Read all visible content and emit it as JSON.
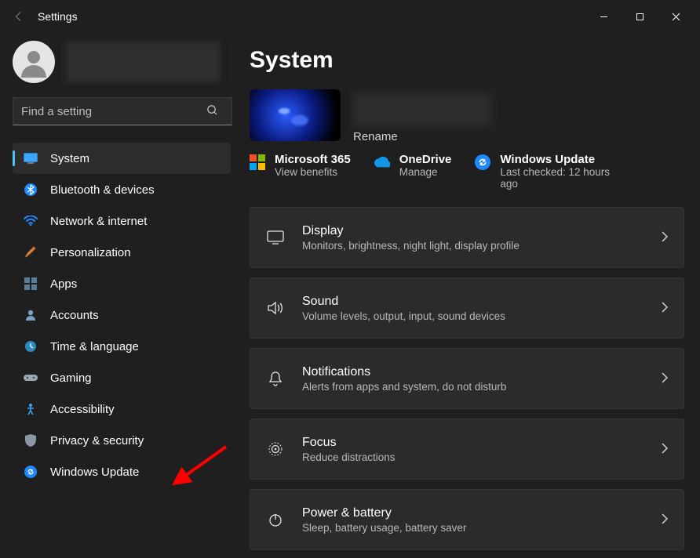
{
  "window": {
    "title": "Settings"
  },
  "search": {
    "placeholder": "Find a setting"
  },
  "nav": {
    "items": [
      {
        "label": "System"
      },
      {
        "label": "Bluetooth & devices"
      },
      {
        "label": "Network & internet"
      },
      {
        "label": "Personalization"
      },
      {
        "label": "Apps"
      },
      {
        "label": "Accounts"
      },
      {
        "label": "Time & language"
      },
      {
        "label": "Gaming"
      },
      {
        "label": "Accessibility"
      },
      {
        "label": "Privacy & security"
      },
      {
        "label": "Windows Update"
      }
    ],
    "active_index": 0
  },
  "page": {
    "title": "System",
    "device": {
      "rename_label": "Rename"
    },
    "tiles": [
      {
        "title": "Microsoft 365",
        "sub": "View benefits"
      },
      {
        "title": "OneDrive",
        "sub": "Manage"
      },
      {
        "title": "Windows Update",
        "sub": "Last checked: 12 hours ago"
      }
    ],
    "cards": [
      {
        "title": "Display",
        "sub": "Monitors, brightness, night light, display profile"
      },
      {
        "title": "Sound",
        "sub": "Volume levels, output, input, sound devices"
      },
      {
        "title": "Notifications",
        "sub": "Alerts from apps and system, do not disturb"
      },
      {
        "title": "Focus",
        "sub": "Reduce distractions"
      },
      {
        "title": "Power & battery",
        "sub": "Sleep, battery usage, battery saver"
      }
    ]
  },
  "annotations": {
    "arrow_points_to": "Windows Update"
  }
}
